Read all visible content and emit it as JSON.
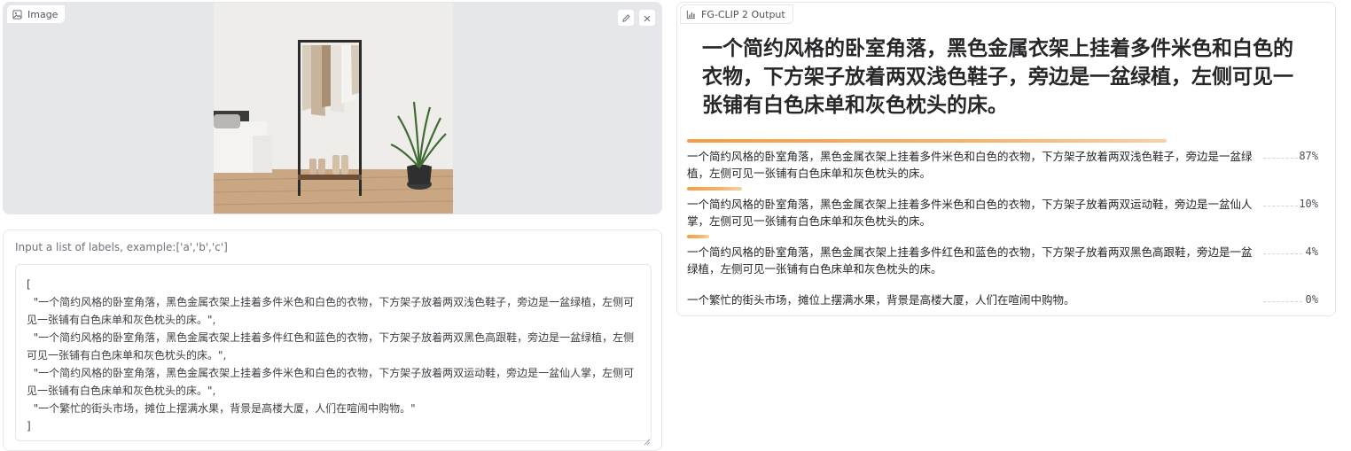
{
  "image_panel": {
    "label": "Image",
    "edit_icon": "pencil-icon",
    "clear_icon": "close-icon"
  },
  "input_panel": {
    "label": "Input a list of labels, example:['a','b','c']",
    "value": "[\n  \"一个简约风格的卧室角落，黑色金属衣架上挂着多件米色和白色的衣物，下方架子放着两双浅色鞋子，旁边是一盆绿植，左侧可见一张铺有白色床单和灰色枕头的床。\",\n  \"一个简约风格的卧室角落，黑色金属衣架上挂着多件红色和蓝色的衣物，下方架子放着两双黑色高跟鞋，旁边是一盆绿植，左侧可见一张铺有白色床单和灰色枕头的床。\",\n  \"一个简约风格的卧室角落，黑色金属衣架上挂着多件米色和白色的衣物，下方架子放着两双运动鞋，旁边是一盆仙人掌，左侧可见一张铺有白色床单和灰色枕头的床。\",\n  \"一个繁忙的街头市场，摊位上摆满水果，背景是高楼大厦，人们在喧闹中购物。\"\n]"
  },
  "output_panel": {
    "label": "FG-CLIP 2 Output",
    "title": "一个简约风格的卧室角落，黑色金属衣架上挂着多件米色和白色的衣物，下方架子放着两双浅色鞋子，旁边是一盆绿植，左侧可见一张铺有白色床单和灰色枕头的床。",
    "results": [
      {
        "label": "一个简约风格的卧室角落，黑色金属衣架上挂着多件米色和白色的衣物，下方架子放着两双浅色鞋子，旁边是一盆绿植，左侧可见一张铺有白色床单和灰色枕头的床。",
        "percent": "87%",
        "confidence": 0.87
      },
      {
        "label": "一个简约风格的卧室角落，黑色金属衣架上挂着多件米色和白色的衣物，下方架子放着两双运动鞋，旁边是一盆仙人掌，左侧可见一张铺有白色床单和灰色枕头的床。",
        "percent": "10%",
        "confidence": 0.1
      },
      {
        "label": "一个简约风格的卧室角落，黑色金属衣架上挂着多件红色和蓝色的衣物，下方架子放着两双黑色高跟鞋，旁边是一盆绿植，左侧可见一张铺有白色床单和灰色枕头的床。",
        "percent": "4%",
        "confidence": 0.04
      },
      {
        "label": "一个繁忙的街头市场，摊位上摆满水果，背景是高楼大厦，人们在喧闹中购物。",
        "percent": "0%",
        "confidence": 0.0
      }
    ]
  },
  "colors": {
    "accent_bar": "#f59e42",
    "panel_border": "#e5e7eb",
    "image_bg": "#e6e7eb"
  }
}
